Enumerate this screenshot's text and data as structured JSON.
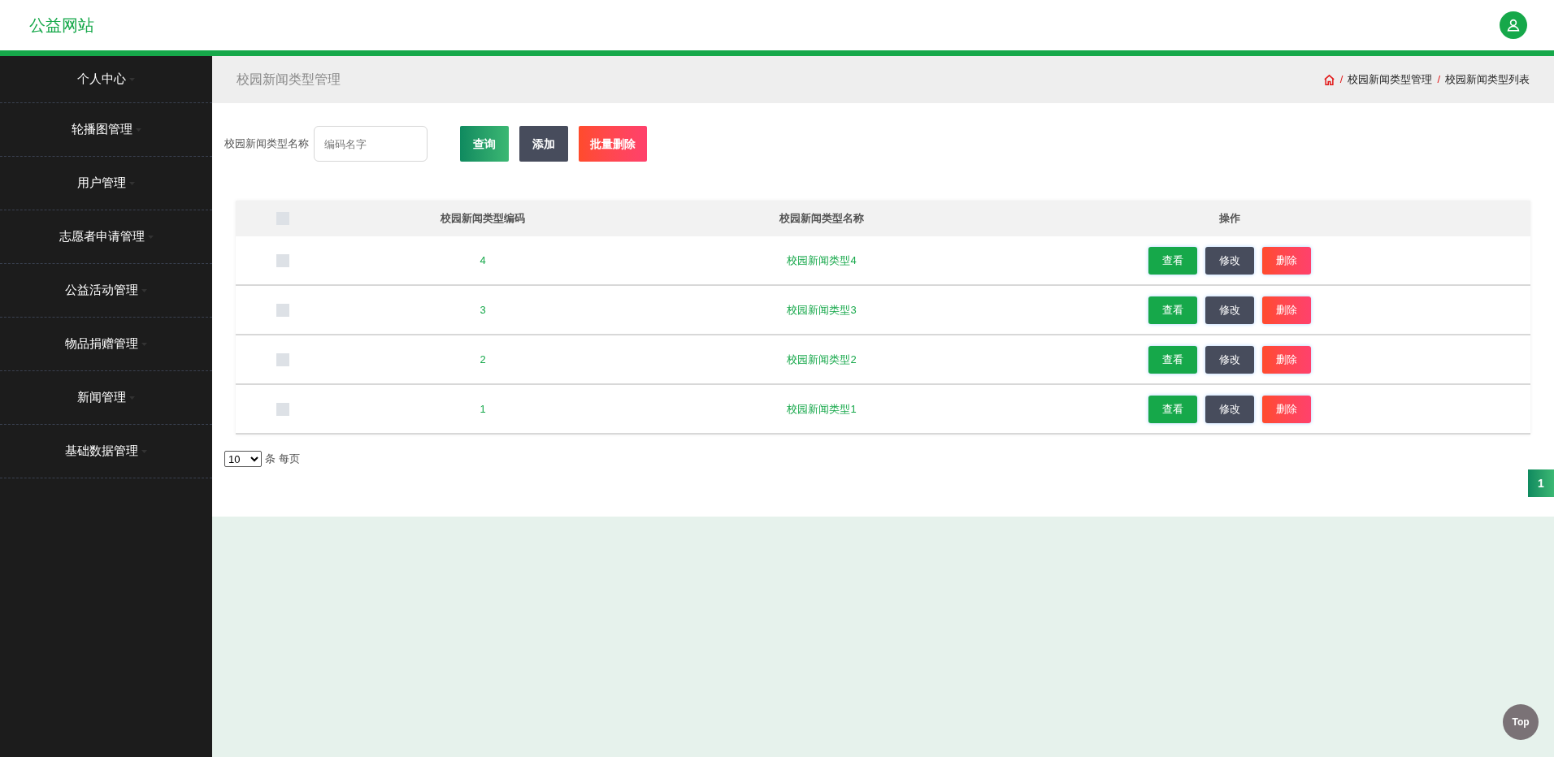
{
  "header": {
    "site_title": "公益网站"
  },
  "sidebar": {
    "items": [
      {
        "label": "个人中心"
      },
      {
        "label": "轮播图管理"
      },
      {
        "label": "用户管理"
      },
      {
        "label": "志愿者申请管理"
      },
      {
        "label": "公益活动管理"
      },
      {
        "label": "物品捐赠管理"
      },
      {
        "label": "新闻管理"
      },
      {
        "label": "基础数据管理"
      }
    ]
  },
  "page_header": {
    "title": "校园新闻类型管理",
    "breadcrumb_separator": "/",
    "breadcrumb": [
      "校园新闻类型管理",
      "校园新闻类型列表"
    ]
  },
  "search": {
    "label": "校园新闻类型名称",
    "placeholder": "编码名字",
    "buttons": [
      {
        "label": "查询",
        "kind": "query"
      },
      {
        "label": "添加",
        "kind": "add"
      },
      {
        "label": "批量删除",
        "kind": "delete"
      }
    ]
  },
  "table": {
    "select_all_checked": false,
    "columns": [
      "校园新闻类型编码",
      "校园新闻类型名称",
      "操作"
    ],
    "rows": [
      {
        "checked": false,
        "code": "4",
        "name": "校园新闻类型4",
        "actions": [
          "查看",
          "修改",
          "删除"
        ]
      },
      {
        "checked": false,
        "code": "3",
        "name": "校园新闻类型3",
        "actions": [
          "查看",
          "修改",
          "删除"
        ]
      },
      {
        "checked": false,
        "code": "2",
        "name": "校园新闻类型2",
        "actions": [
          "查看",
          "修改",
          "删除"
        ]
      },
      {
        "checked": false,
        "code": "1",
        "name": "校园新闻类型1",
        "actions": [
          "查看",
          "修改",
          "删除"
        ]
      }
    ]
  },
  "pagination": {
    "page_size": "10",
    "page_size_label": "条 每页",
    "pages": [
      {
        "label": "1",
        "selected": true
      }
    ]
  },
  "back_to_top": "Top"
}
